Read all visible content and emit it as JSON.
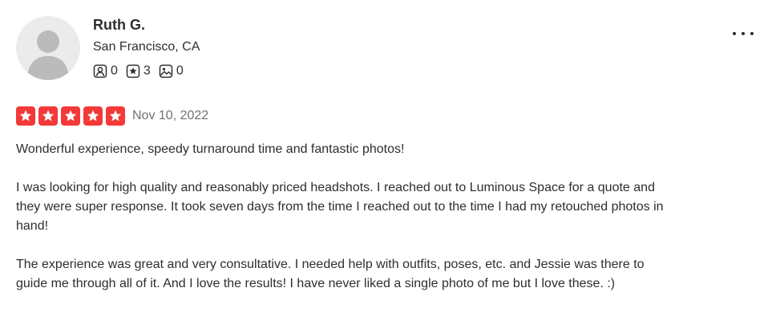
{
  "reviewer": {
    "name": "Ruth G.",
    "location": "San Francisco, CA",
    "stats": [
      {
        "icon": "friends-icon",
        "value": "0"
      },
      {
        "icon": "reviews-star-icon",
        "value": "3"
      },
      {
        "icon": "photos-icon",
        "value": "0"
      }
    ]
  },
  "review": {
    "rating": 5,
    "rating_max": 5,
    "date": "Nov 10, 2022",
    "paragraphs": [
      "Wonderful experience, speedy turnaround time and fantastic photos!",
      "I was looking for high quality and reasonably priced headshots. I reached out to Luminous Space for a quote and they were super response. It took seven days from the time I reached out to the time I had my retouched photos in hand!",
      "The experience was great and very consultative. I needed help with outfits, poses, etc. and Jessie was there to guide me through all of it. And I love the results! I have never liked a single photo of me but I love these. :)"
    ]
  },
  "colors": {
    "star": "#f43939",
    "text": "#2d2e2f",
    "muted": "#6e7072",
    "avatar_bg": "#ebebeb",
    "avatar_fg": "#bbbbbb"
  }
}
